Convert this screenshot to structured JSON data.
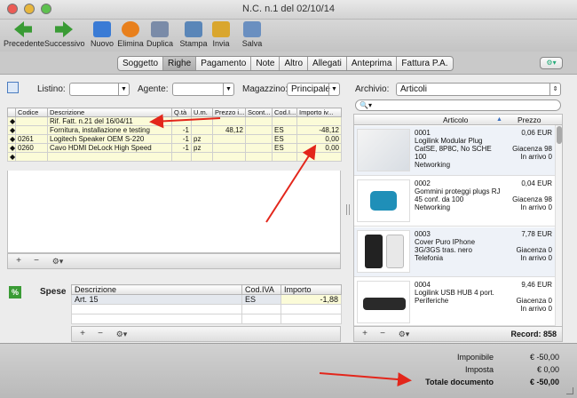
{
  "window": {
    "title": "N.C. n.1 del 02/10/14"
  },
  "toolbar": [
    {
      "label": "Precedente",
      "color": "#3a9b35"
    },
    {
      "label": "Successivo",
      "color": "#3a9b35"
    },
    {
      "label": "Nuovo",
      "color": "#3a7bd5"
    },
    {
      "label": "Elimina",
      "color": "#e8801d"
    },
    {
      "label": "Duplica",
      "color": "#7a8ba8"
    },
    {
      "label": "Stampa",
      "color": "#5a86b8"
    },
    {
      "label": "Invia",
      "color": "#d9a62e"
    },
    {
      "label": "Salva",
      "color": "#6a8fc0"
    }
  ],
  "tabs": [
    "Soggetto",
    "Righe",
    "Pagamento",
    "Note",
    "Altro",
    "Allegati",
    "Anteprima",
    "Fattura P.A."
  ],
  "active_tab": "Righe",
  "filters": {
    "listino_label": "Listino:",
    "agente_label": "Agente:",
    "magazzino_label": "Magazzino:",
    "magazzino_value": "Principale",
    "archivio_label": "Archivio:",
    "archivio_value": "Articoli"
  },
  "righe": {
    "columns": [
      "Codice",
      "Descrizione",
      "Q.tà",
      "U.m.",
      "Prezzo i...",
      "Scont...",
      "Cod.I...",
      "Importo iv..."
    ],
    "rows": [
      {
        "codice": "",
        "descrizione": "Rif. Fatt. n.21 del 16/04/11",
        "qta": "",
        "um": "",
        "prezzo": "",
        "sconto": "",
        "iva": "",
        "importo": ""
      },
      {
        "codice": "",
        "descrizione": "Fornitura, installazione e testing",
        "qta": "-1",
        "um": "",
        "prezzo": "48,12",
        "sconto": "",
        "iva": "ES",
        "importo": "-48,12"
      },
      {
        "codice": "0261",
        "descrizione": "Logitech Speaker OEM S-220",
        "qta": "-1",
        "um": "pz",
        "prezzo": "",
        "sconto": "",
        "iva": "ES",
        "importo": "0,00"
      },
      {
        "codice": "0260",
        "descrizione": "Cavo HDMI DeLock High Speed",
        "qta": "-1",
        "um": "pz",
        "prezzo": "",
        "sconto": "",
        "iva": "ES",
        "importo": "0,00"
      },
      {
        "codice": "",
        "descrizione": "",
        "qta": "",
        "um": "",
        "prezzo": "",
        "sconto": "",
        "iva": "",
        "importo": ""
      }
    ]
  },
  "catalog": {
    "columns": [
      "Articolo",
      "Prezzo"
    ],
    "items": [
      {
        "code": "0001",
        "name": "Logilink Modular Plug CatSE, 8P8C, No SCHE 100",
        "category": "Networking",
        "price": "0,06 EUR",
        "giacenza": "Giacenza 98",
        "arrivo": "In arrivo 0"
      },
      {
        "code": "0002",
        "name": "Gommini proteggi plugs RJ 45 conf. da 100",
        "category": "Networking",
        "price": "0,04 EUR",
        "giacenza": "Giacenza 98",
        "arrivo": "In arrivo 0"
      },
      {
        "code": "0003",
        "name": "Cover Puro IPhone 3G/3GS tras. nero",
        "category": "Telefonia",
        "price": "7,78 EUR",
        "giacenza": "Giacenza 0",
        "arrivo": "In arrivo 0"
      },
      {
        "code": "0004",
        "name": "Logilink USB HUB 4 port.",
        "category": "Periferiche",
        "price": "9,46 EUR",
        "giacenza": "Giacenza 0",
        "arrivo": "In arrivo 0"
      }
    ],
    "record_label": "Record: 858"
  },
  "spese": {
    "label": "Spese",
    "columns": [
      "Descrizione",
      "Cod.IVA",
      "Importo"
    ],
    "rows": [
      {
        "descrizione": "Art. 15",
        "iva": "ES",
        "importo": "-1,88"
      }
    ]
  },
  "totals": {
    "imponibile_label": "Imponibile",
    "imponibile": "€ -50,00",
    "imposta_label": "Imposta",
    "imposta": "€ 0,00",
    "totale_label": "Totale documento",
    "totale": "€ -50,00"
  }
}
